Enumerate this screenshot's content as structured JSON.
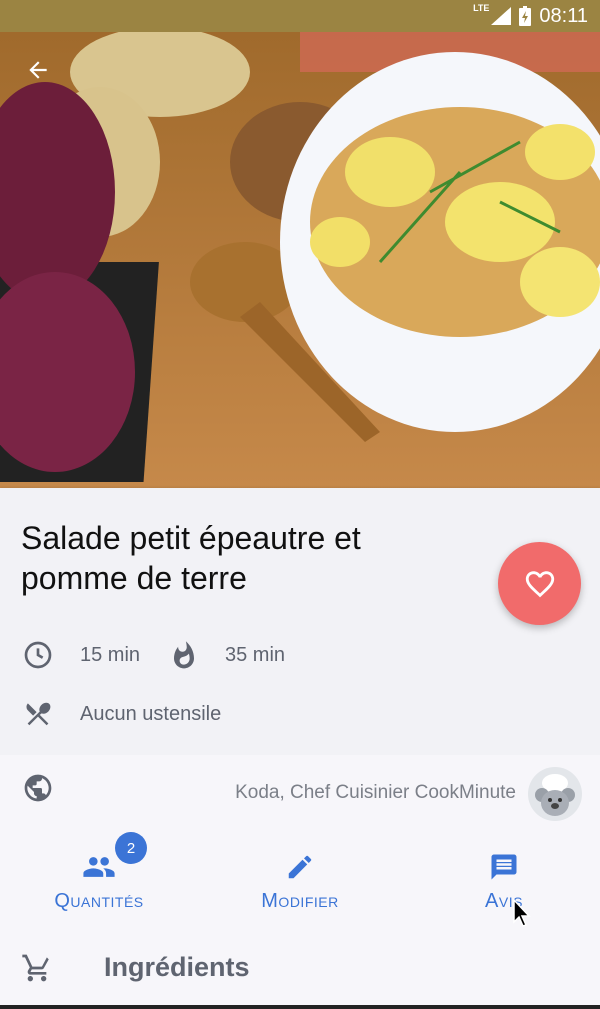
{
  "status_bar": {
    "network": "LTE",
    "time": "08:11"
  },
  "recipe": {
    "title": "Salade petit épeautre et pomme de terre",
    "prep_time": "15 min",
    "cook_time": "35 min",
    "utensils": "Aucun ustensile",
    "author": "Koda, Chef Cuisinier CookMinute"
  },
  "actions": {
    "quantities_label": "Quantités",
    "quantities_badge": "2",
    "edit_label": "Modifier",
    "reviews_label": "Avis"
  },
  "section": {
    "ingredients_title": "Ingrédients"
  },
  "colors": {
    "status_bar": "#9b8442",
    "accent": "#3b74d6",
    "favorite": "#f16b6b"
  },
  "icons": [
    "back-arrow-icon",
    "heart-icon",
    "clock-icon",
    "flame-icon",
    "utensils-icon",
    "globe-icon",
    "people-icon",
    "pencil-icon",
    "comment-icon",
    "cart-icon"
  ]
}
